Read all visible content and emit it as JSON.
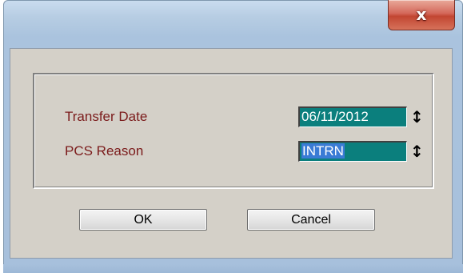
{
  "window": {
    "close_glyph": "x",
    "close_icon": "close-icon"
  },
  "form": {
    "transfer_date_label": "Transfer Date",
    "transfer_date_value": "06/11/2012",
    "pcs_reason_label": "PCS Reason",
    "pcs_reason_value": "INTRN",
    "spinner_icon": "up-down-arrow-icon",
    "spinner_glyph": "↕"
  },
  "buttons": {
    "ok_label": "OK",
    "cancel_label": "Cancel"
  },
  "colors": {
    "label_text": "#7b1b1b",
    "field_background": "#0b7f7d",
    "selection": "#3a7bd5",
    "dialog_background": "#d4d0c8",
    "close_button": "#c24632"
  }
}
